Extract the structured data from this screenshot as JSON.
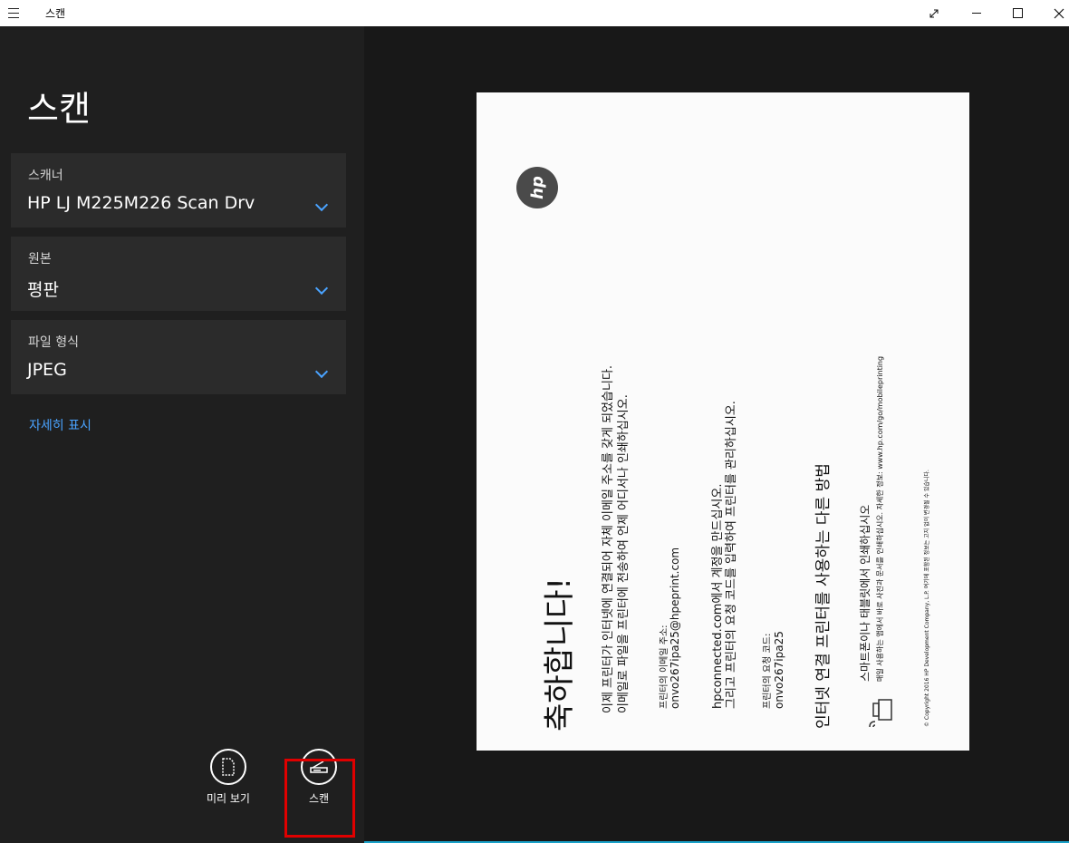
{
  "window": {
    "title": "스캔"
  },
  "page": {
    "title": "스캔"
  },
  "fields": [
    {
      "label": "스캐너",
      "value": "HP LJ M225M226 Scan Drv"
    },
    {
      "label": "원본",
      "value": "평판"
    },
    {
      "label": "파일 형식",
      "value": "JPEG"
    }
  ],
  "more_link": "자세히 표시",
  "appbar": {
    "preview_label": "미리 보기",
    "scan_label": "스캔"
  },
  "document": {
    "logo": "hp",
    "title": "축하합니다!",
    "body_line1": "이제 프린터가 인터넷에 연결되어 자체 이메일 주소를 갖게 되었습니다.",
    "body_line2": "이메일로 파일을 프린터에 전송하여 언제 어디서나 인쇄하십시오.",
    "email_label": "프린터의 이메일 주소:",
    "email_value": "onvo267ipa25@hpeprint.com",
    "connected_line1": "hpconnected.com에서 계정을 만드십시오.",
    "connected_line2": "그리고 프린터의 요청 코드를 입력하여 프린터를 관리하십시오.",
    "code_label": "프린터의 요청 코드:",
    "code_value": "onvo267ipa25",
    "other_title": "인터넷 연결 프린터를 사용하는 다른 방법",
    "smart_line": "스마트폰이나 태블릿에서 인쇄하십시오",
    "smart_sub": "매일 사용하는 앱에서 바로 사진과 문서를 인쇄하십시오. 자세한 정보: www.hp.com/go/mobileprinting",
    "copyright": "© Copyright 2016 HP Development Company, L.P. 여기에 포함된 정보는 고지 없이 변경될 수 있습니다."
  },
  "icons": {
    "menu": "hamburger-icon",
    "fullscreen": "fullscreen-icon",
    "minimize": "minimize-icon",
    "maximize": "maximize-icon",
    "close": "close-icon",
    "preview": "preview-document-icon",
    "scan": "scanner-icon"
  },
  "colors": {
    "accent": "#4aa3ff",
    "highlight": "#e00000",
    "background": "#1f1f1f"
  }
}
